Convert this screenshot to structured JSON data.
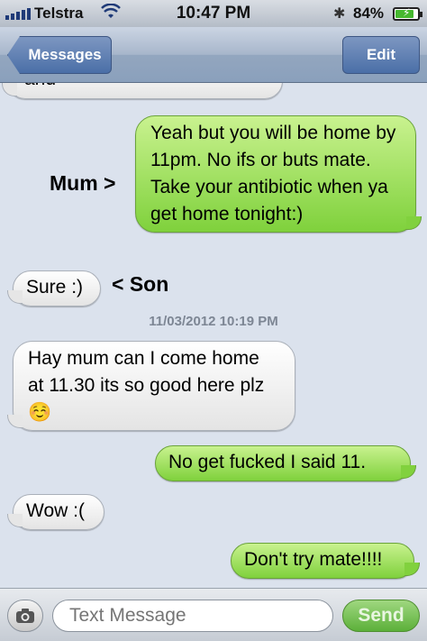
{
  "status_bar": {
    "carrier": "Telstra",
    "time": "10:47 PM",
    "battery_percent": "84%",
    "battery_level": 0.84,
    "icons": [
      "signal-bars-icon",
      "wifi-icon",
      "bluetooth-icon",
      "battery-charging-icon"
    ]
  },
  "navbar": {
    "back_label": "Messages",
    "edit_label": "Edit"
  },
  "messages": [
    {
      "side": "in",
      "text": "and",
      "partial": true
    },
    {
      "side": "out",
      "text": "Yeah but you will be home by 11pm. No ifs or buts mate. Take your antibiotic when ya get home tonight:)"
    },
    {
      "side": "in",
      "text": "Sure :)"
    },
    {
      "side": "in",
      "text": "Hay mum can I come home at 11.30 its so good here plz ☺️"
    },
    {
      "side": "out",
      "text": "No get fucked I said 11."
    },
    {
      "side": "in",
      "text": "Wow :("
    },
    {
      "side": "out",
      "text": "Don't try mate!!!!"
    }
  ],
  "annotations": {
    "mum": "Mum >",
    "son": "< Son"
  },
  "timestamp": "11/03/2012 10:19 PM",
  "composer": {
    "placeholder": "Text Message",
    "send_label": "Send"
  },
  "colors": {
    "outgoing_bubble": "#7fd13c",
    "incoming_bubble": "#ffffff",
    "chat_background": "#dbe2ed",
    "nav_button": "#4a6fa7"
  }
}
